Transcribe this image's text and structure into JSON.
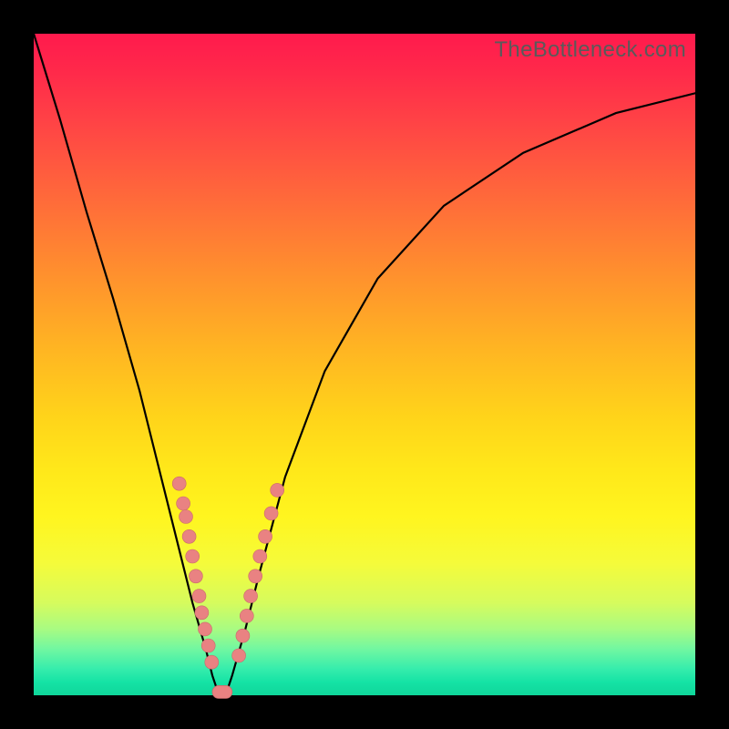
{
  "watermark": "TheBottleneck.com",
  "colors": {
    "dot": "#e98282",
    "curve": "#000000"
  },
  "chart_data": {
    "type": "line",
    "title": "",
    "subtitle": "",
    "xlabel": "",
    "ylabel": "",
    "xlim": [
      0,
      100
    ],
    "ylim": [
      0,
      100
    ],
    "grid": false,
    "legend": false,
    "annotations": [
      "TheBottleneck.com"
    ],
    "series": [
      {
        "name": "bottleneck-curve",
        "comment": "V-shaped curve; y is percent-of-range height. Values eyeballed from pixel positions.",
        "x": [
          0,
          4,
          8,
          12,
          16,
          20,
          22,
          24,
          26,
          27,
          28,
          29,
          30,
          32,
          34,
          38,
          44,
          52,
          62,
          74,
          88,
          100
        ],
        "y": [
          100,
          87,
          73,
          60,
          46,
          30,
          22,
          14,
          7,
          3,
          0,
          0,
          3,
          10,
          18,
          33,
          49,
          63,
          74,
          82,
          88,
          91
        ]
      }
    ],
    "markers": {
      "comment": "Pink dot clusters near the trough on both arms, plus rounded bar at bottom.",
      "left_arm": [
        {
          "x": 22,
          "y": 32
        },
        {
          "x": 22.6,
          "y": 29
        },
        {
          "x": 23,
          "y": 27
        },
        {
          "x": 23.5,
          "y": 24
        },
        {
          "x": 24,
          "y": 21
        },
        {
          "x": 24.5,
          "y": 18
        },
        {
          "x": 25,
          "y": 15
        },
        {
          "x": 25.4,
          "y": 12.5
        },
        {
          "x": 25.9,
          "y": 10
        },
        {
          "x": 26.4,
          "y": 7.5
        },
        {
          "x": 26.9,
          "y": 5
        }
      ],
      "right_arm": [
        {
          "x": 31,
          "y": 6
        },
        {
          "x": 31.6,
          "y": 9
        },
        {
          "x": 32.2,
          "y": 12
        },
        {
          "x": 32.8,
          "y": 15
        },
        {
          "x": 33.5,
          "y": 18
        },
        {
          "x": 34.2,
          "y": 21
        },
        {
          "x": 35,
          "y": 24
        },
        {
          "x": 35.9,
          "y": 27.5
        },
        {
          "x": 36.8,
          "y": 31
        }
      ],
      "bottom_bar": {
        "x0": 27,
        "x1": 30,
        "y": 0.5
      }
    }
  }
}
